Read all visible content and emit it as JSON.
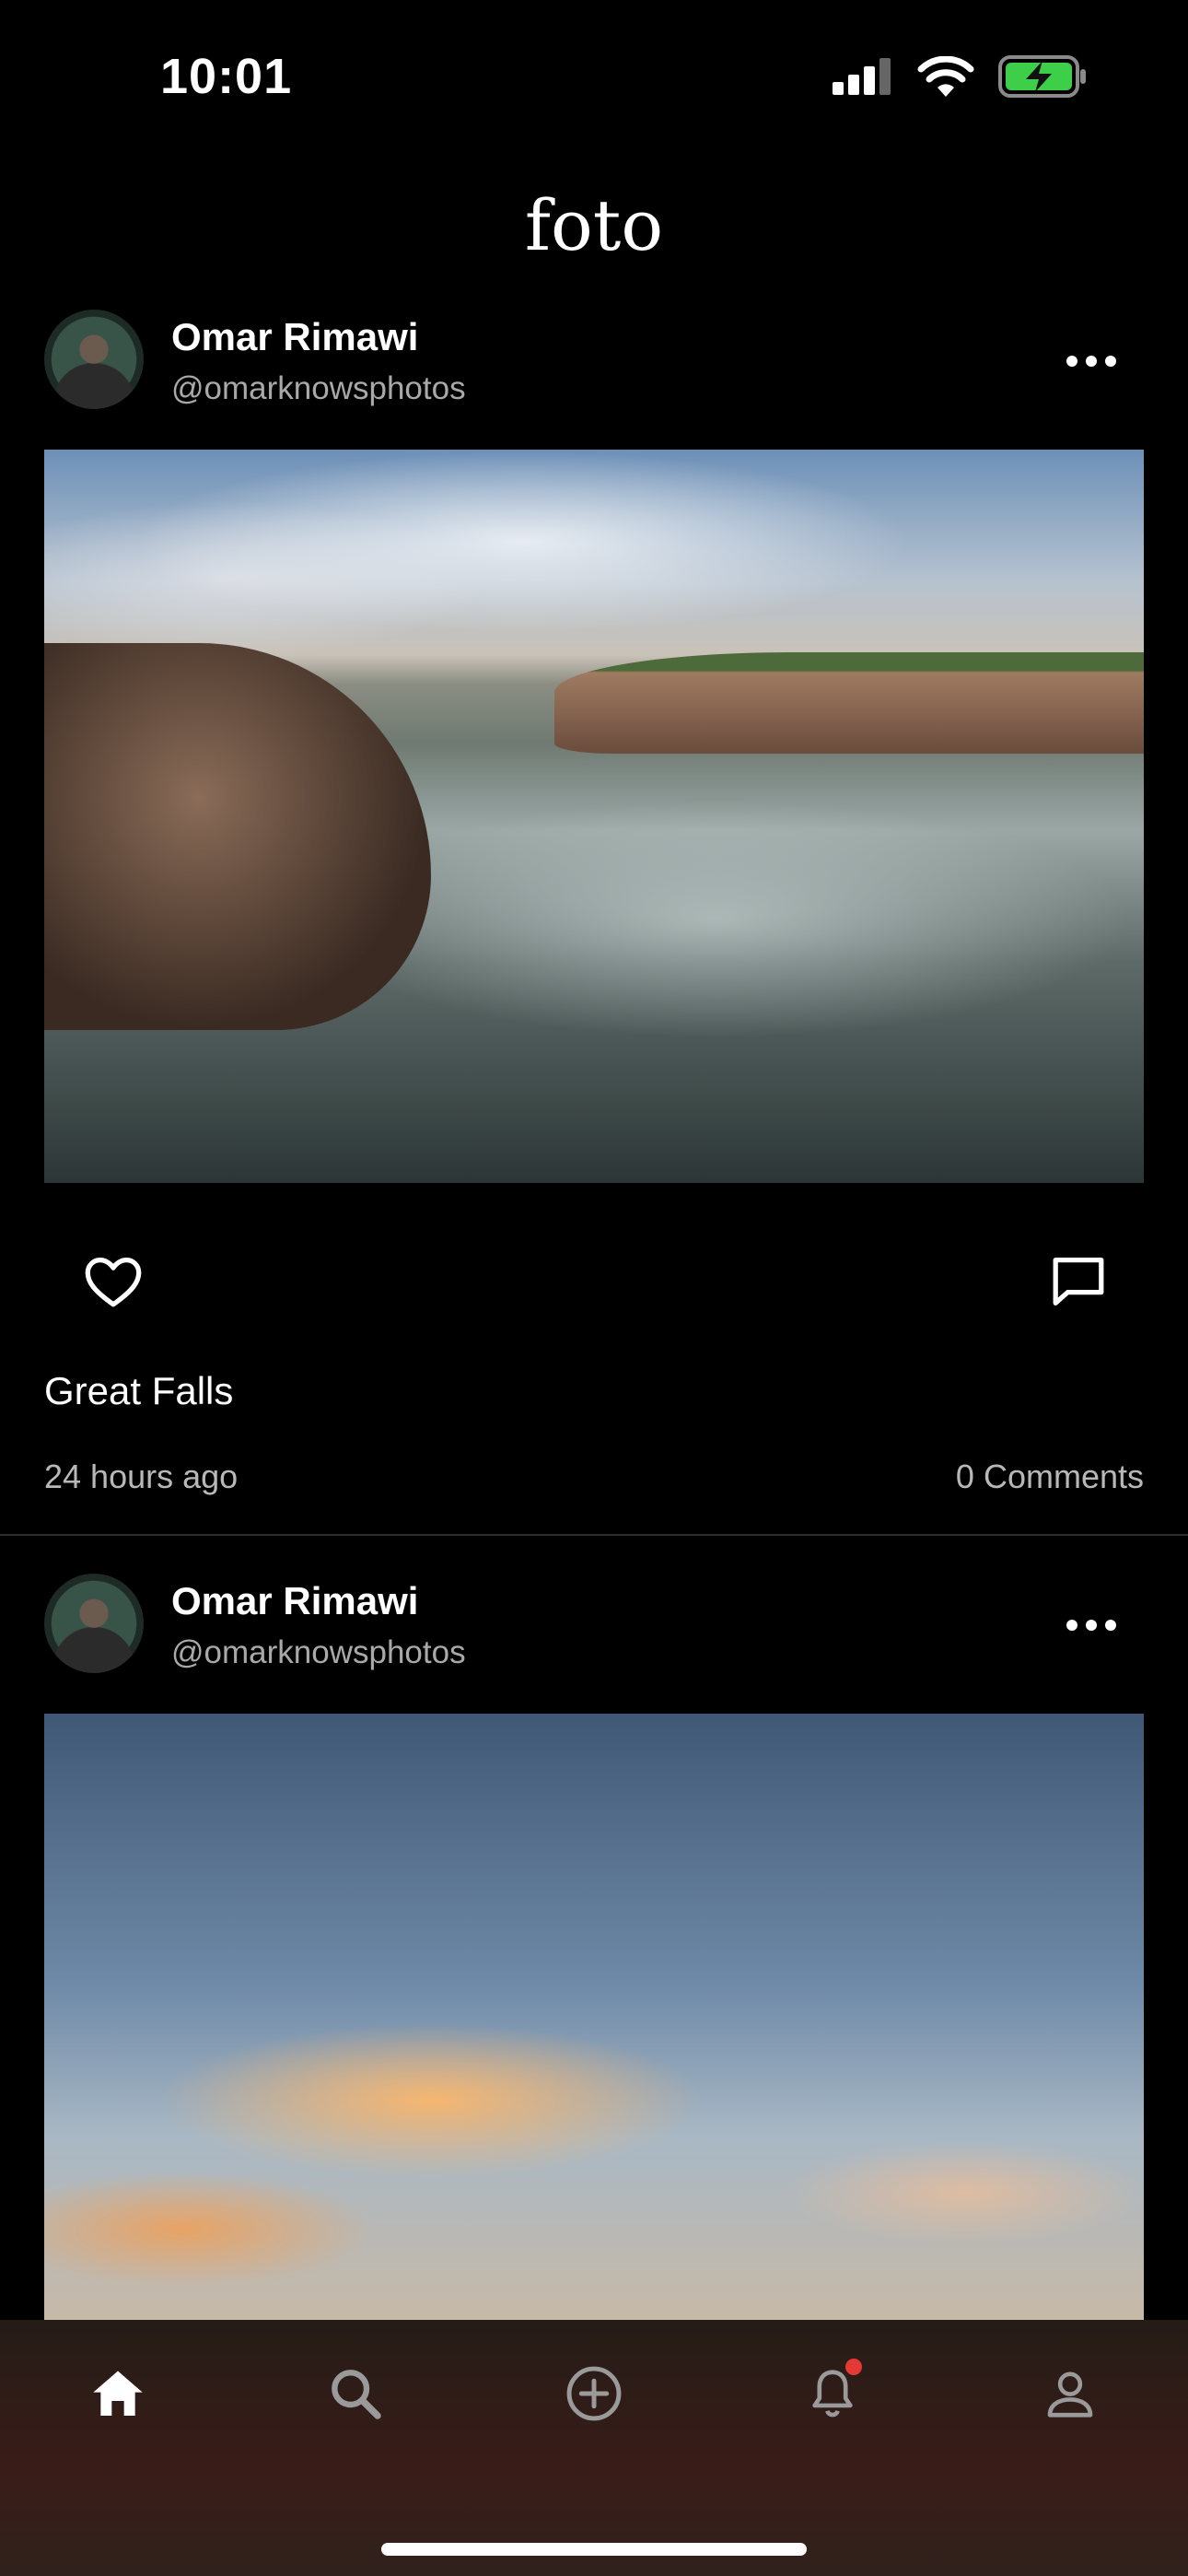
{
  "status_bar": {
    "time": "10:01",
    "battery_color": "#3ecf4a"
  },
  "header": {
    "app_title": "foto"
  },
  "posts": [
    {
      "author_name": "Omar Rimawi",
      "author_handle": "@omarknowsphotos",
      "photo_subject": "river rapids with rocky banks under a cloudy sky",
      "caption": "Great Falls",
      "time_ago": "24 hours ago",
      "comments_label": "0 Comments"
    },
    {
      "author_name": "Omar Rimawi",
      "author_handle": "@omarknowsphotos",
      "photo_subject": "sunset clouds over a blue sky"
    }
  ],
  "tab_bar": {
    "tabs": [
      {
        "name": "home",
        "icon": "home-icon",
        "active": true
      },
      {
        "name": "search",
        "icon": "search-icon",
        "active": false
      },
      {
        "name": "create",
        "icon": "plus-circle-icon",
        "active": false
      },
      {
        "name": "notifications",
        "icon": "bell-icon",
        "active": false,
        "badge": true
      },
      {
        "name": "profile",
        "icon": "person-icon",
        "active": false
      }
    ],
    "active_color": "#ffffff",
    "inactive_color": "#9a9a9a",
    "badge_color": "#e53935"
  }
}
